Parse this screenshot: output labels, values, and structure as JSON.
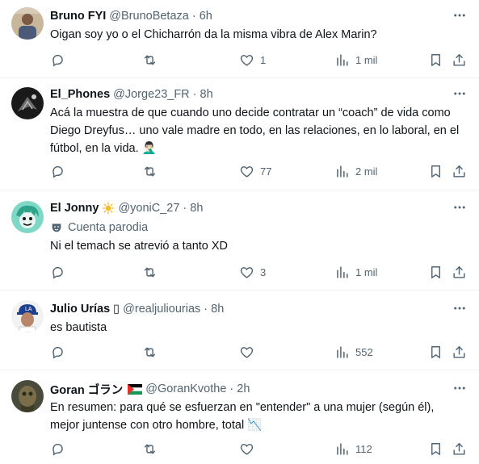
{
  "tweets": [
    {
      "name": "Bruno FYI",
      "handle": "@BrunoBetaza",
      "sep": "·",
      "time": "6h",
      "text": "Oigan soy yo o  el Chicharrón da la misma vibra de Alex Marin?",
      "likes": "1",
      "views": "1 mil"
    },
    {
      "name": "El_Phones",
      "handle": "@Jorge23_FR",
      "sep": "·",
      "time": "8h",
      "text": "Acá la muestra de que cuando uno decide contratar un “coach” de vida como Diego Dreyfus… uno vale madre en todo, en las relaciones, en lo laboral, en el fútbol, en la vida. 🤦🏻‍♂️",
      "likes": "77",
      "views": "2 mil"
    },
    {
      "name": "El Jonny",
      "handle": "@yoniC_27",
      "sep": "·",
      "time": "8h",
      "parody_label": "Cuenta parodia",
      "text": "Ni el temach se atrevió a tanto XD",
      "likes": "3",
      "views": "1 mil"
    },
    {
      "name": "Julio Urías ▯",
      "handle": "@realjuliourias",
      "sep": "·",
      "time": "8h",
      "text": "es bautista",
      "likes": "",
      "views": "552"
    },
    {
      "name": "Goran ゴラン",
      "handle": "@GoranKvothe",
      "sep": "·",
      "time": "2h",
      "text": "En resumen: para qué se esfuerzan en \"entender\" a una mujer (según él), mejor juntense con otro hombre, total 📉",
      "likes": "",
      "views": "112"
    }
  ],
  "colors": {
    "text": "#0f1419",
    "secondary": "#536471",
    "divider": "#eff3f4"
  },
  "icons": [
    "reply-icon",
    "retweet-icon",
    "like-icon",
    "views-icon",
    "bookmark-icon",
    "share-icon",
    "more-icon",
    "parody-mask-icon",
    "palestine-flag-icon",
    "star-badge-icon"
  ]
}
